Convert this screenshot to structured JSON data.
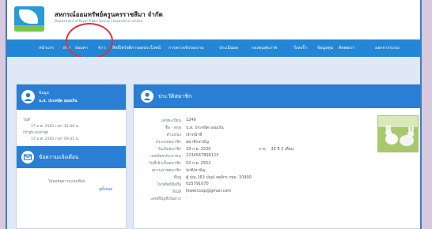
{
  "header": {
    "org_name": "สหกรณ์ออมทรัพย์ครูนครราชสีมา จำกัด",
    "org_name_en": "Department of Royal Public Saving Cooperative Limited"
  },
  "nav": {
    "items": [
      "หน้าแรก",
      "ฝาก",
      "ย่อมค่า",
      "ข่าว",
      "สิทธิ์/สวัสดิการผลประโยชน์",
      "การตรวจรับรองงาน",
      "ประเมินผล",
      "กองทุนสุขภาพ",
      "วิ่งลงรั้ว",
      "ข้อมูลทุน",
      "ติดต่อเรา",
      "ออกจากระบบ"
    ]
  },
  "sidebar": {
    "user_title": "ข้อมูล",
    "user_name": "น.ส. ประหยัด ออมเงิน",
    "login_label": "วันที่",
    "login_time": "17 ม.ค. 2561 เวลา 12:09 น.",
    "last_access_label": "เข้าสู่ระบบล่าสุด",
    "last_access_time": "17 ม.ค. 2561 เวลา 09:45 น.",
    "messages_title": "ข้อความแจ้งเตือน",
    "no_messages": "ไม่พบข้อความแจ้งเตือน",
    "read_all": "ดูทั้งหมด"
  },
  "profile": {
    "title": "ประวัติสมาชิก",
    "fields": [
      {
        "label": "เลขทะเบียน",
        "value": "1249"
      },
      {
        "label": "ชื่อ - สกุล",
        "value": "น.ส. ประหยัด ออมเงิน"
      },
      {
        "label": "ตำแหน่ง",
        "value": "เจ้าหน้าที่"
      },
      {
        "label": "ประเภทสมาชิก",
        "value": "สมาชิกสามัญ"
      },
      {
        "label": "วันเกิดสมาชิก",
        "value": "19 ก.ย. 2530"
      },
      {
        "label": "เลขบัตรประชาชน",
        "value": "1234567890123"
      },
      {
        "label": "วันที่เข้าเป็นสมาชิก",
        "value": "02 ก.ย. 2552"
      },
      {
        "label": "สถานภาพสมาชิก",
        "value": "ปกติ/สามัญ"
      },
      {
        "label": "ที่อยู่",
        "value": "ตู้ ปณ.163 ปณฝ.จตุจักร กทม. 10900"
      },
      {
        "label": "โทรศัพท์มือถือ",
        "value": "025791070"
      },
      {
        "label": "อีเมล์",
        "value": "fewercoop@gmail.com"
      },
      {
        "label": "เลขที่บัญชีเงินฝาก",
        "value": "-"
      }
    ],
    "age_label": "อายุ",
    "age_value": "30 ปี 3 เดือน"
  },
  "colors": {
    "nav_blue": "#2386d6",
    "panel_blue": "#2a7fd4",
    "highlight_red": "#d6363c",
    "frame_purple": "#d9c9de"
  }
}
